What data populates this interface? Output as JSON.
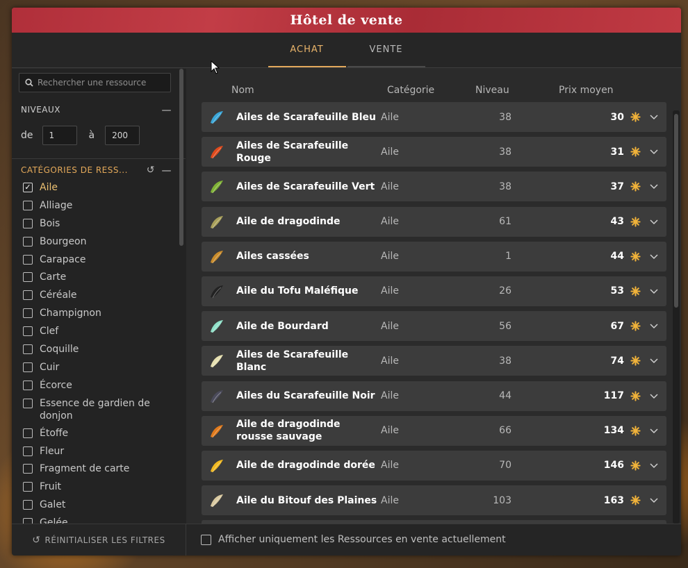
{
  "window": {
    "title": "Hôtel de vente"
  },
  "tabs": [
    {
      "label": "ACHAT",
      "active": true
    },
    {
      "label": "VENTE",
      "active": false
    }
  ],
  "sidebar": {
    "search": {
      "placeholder": "Rechercher une ressource",
      "value": ""
    },
    "levels": {
      "title": "NIVEAUX",
      "from_label": "de",
      "from_value": "1",
      "to_label": "à",
      "to_value": "200"
    },
    "categories": {
      "title": "CATÉGORIES DE RESS...",
      "items": [
        {
          "label": "Aile",
          "checked": true
        },
        {
          "label": "Alliage",
          "checked": false
        },
        {
          "label": "Bois",
          "checked": false
        },
        {
          "label": "Bourgeon",
          "checked": false
        },
        {
          "label": "Carapace",
          "checked": false
        },
        {
          "label": "Carte",
          "checked": false
        },
        {
          "label": "Céréale",
          "checked": false
        },
        {
          "label": "Champignon",
          "checked": false
        },
        {
          "label": "Clef",
          "checked": false
        },
        {
          "label": "Coquille",
          "checked": false
        },
        {
          "label": "Cuir",
          "checked": false
        },
        {
          "label": "Écorce",
          "checked": false
        },
        {
          "label": "Essence de gardien de donjon",
          "checked": false
        },
        {
          "label": "Étoffe",
          "checked": false
        },
        {
          "label": "Fleur",
          "checked": false
        },
        {
          "label": "Fragment de carte",
          "checked": false
        },
        {
          "label": "Fruit",
          "checked": false
        },
        {
          "label": "Galet",
          "checked": false
        },
        {
          "label": "Gelée",
          "checked": false
        }
      ]
    }
  },
  "table": {
    "columns": {
      "name": "Nom",
      "category": "Catégorie",
      "level": "Niveau",
      "price": "Prix moyen"
    },
    "rows": [
      {
        "name": "Ailes de Scarafeuille Bleu",
        "category": "Aile",
        "level": "38",
        "price": "30",
        "icon": "blue-wing-icon",
        "color": "#3aa7d9"
      },
      {
        "name": "Ailes de Scarafeuille Rouge",
        "category": "Aile",
        "level": "38",
        "price": "31",
        "icon": "red-wing-icon",
        "color": "#e04a1c"
      },
      {
        "name": "Ailes de Scarafeuille Vert",
        "category": "Aile",
        "level": "38",
        "price": "37",
        "icon": "green-wing-icon",
        "color": "#7fb235"
      },
      {
        "name": "Aile de dragodinde",
        "category": "Aile",
        "level": "61",
        "price": "43",
        "icon": "dragodinde-wing-icon",
        "color": "#a9a05a"
      },
      {
        "name": "Ailes cassées",
        "category": "Aile",
        "level": "1",
        "price": "44",
        "icon": "broken-wings-icon",
        "color": "#c98b2a"
      },
      {
        "name": "Aile du Tofu Maléfique",
        "category": "Aile",
        "level": "26",
        "price": "53",
        "icon": "dark-tofu-wing-icon",
        "color": "#222222"
      },
      {
        "name": "Aile de Bourdard",
        "category": "Aile",
        "level": "56",
        "price": "67",
        "icon": "bourdard-wing-icon",
        "color": "#8fe0c8"
      },
      {
        "name": "Ailes de Scarafeuille Blanc",
        "category": "Aile",
        "level": "38",
        "price": "74",
        "icon": "white-wing-icon",
        "color": "#e6e0b0"
      },
      {
        "name": "Ailes du Scarafeuille Noir",
        "category": "Aile",
        "level": "44",
        "price": "117",
        "icon": "black-wing-icon",
        "color": "#4a4a5a"
      },
      {
        "name": "Aile de dragodinde rousse sauvage",
        "category": "Aile",
        "level": "66",
        "price": "134",
        "icon": "red-dragodinde-wing-icon",
        "color": "#e07a1c"
      },
      {
        "name": "Aile de dragodinde dorée",
        "category": "Aile",
        "level": "70",
        "price": "146",
        "icon": "golden-dragodinde-wing-icon",
        "color": "#f0b820"
      },
      {
        "name": "Aile du Bitouf des Plaines",
        "category": "Aile",
        "level": "103",
        "price": "163",
        "icon": "bitouf-wing-icon",
        "color": "#d9c9a0"
      }
    ]
  },
  "footer": {
    "reset_label": "RÉINITIALISER LES FILTRES",
    "only_on_sale_label": "Afficher uniquement les Ressources en vente actuellement",
    "only_on_sale_checked": false
  },
  "colors": {
    "title_bar": "#b5333d",
    "accent": "#e2a95c",
    "kama": "#f0b23a"
  }
}
